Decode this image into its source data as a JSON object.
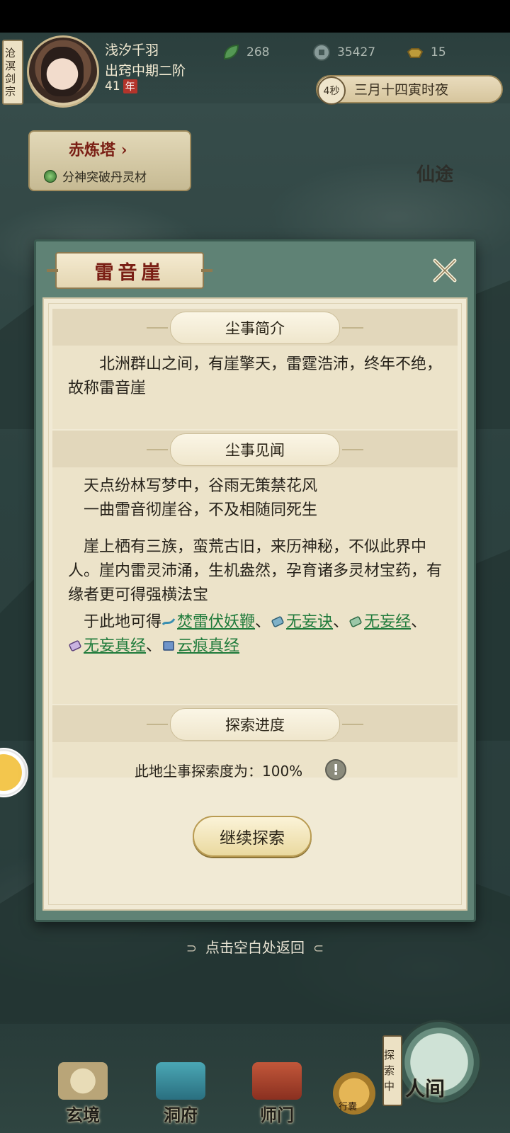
{
  "player": {
    "sect": "沧溟剑宗",
    "name": "浅汐千羽",
    "realm": "出窍中期二阶",
    "age": "41",
    "age_unit": "年"
  },
  "resources": [
    {
      "icon": "jade-leaf-icon",
      "value": "268"
    },
    {
      "icon": "coin-icon",
      "value": "35427"
    },
    {
      "icon": "gold-ingot-icon",
      "value": "15"
    }
  ],
  "time": {
    "countdown": "4秒",
    "label": "三月十四寅时夜"
  },
  "tower": {
    "title": "赤炼塔",
    "subtitle": "分神突破丹灵材"
  },
  "map_seal": "仙途",
  "modal": {
    "title": "雷音崖",
    "sections": {
      "intro": {
        "header": "尘事简介",
        "text": "北洲群山之间，有崖擎天，雷霆浩沛，终年不绝，故称雷音崖"
      },
      "lore": {
        "header": "尘事见闻",
        "poem_line1": "天点纷林写梦中，谷雨无策禁花风",
        "poem_line2": "一曲雷音彻崖谷，不及相随同死生",
        "description": "崖上栖有三族，蛮荒古旧，来历神秘，不似此界中人。崖内雷灵沛涌，生机盎然，孕育诸多灵材宝药，有缘者更可得强横法宝",
        "obtain_prefix": "于此地可得",
        "items": [
          "焚雷伏妖鞭",
          "无妄诀",
          "无妄经",
          "无妄真经",
          "云痕真经"
        ],
        "separator": "、"
      },
      "progress": {
        "header": "探索进度",
        "text": "此地尘事探索度为：100%"
      }
    },
    "continue_label": "继续探索"
  },
  "hint": "点击空白处返回",
  "bottom_nav": {
    "tabs": [
      "玄境",
      "洞府",
      "师门"
    ],
    "bag_label": "行囊",
    "explore_status": "探索中",
    "realm_label": "人间"
  }
}
